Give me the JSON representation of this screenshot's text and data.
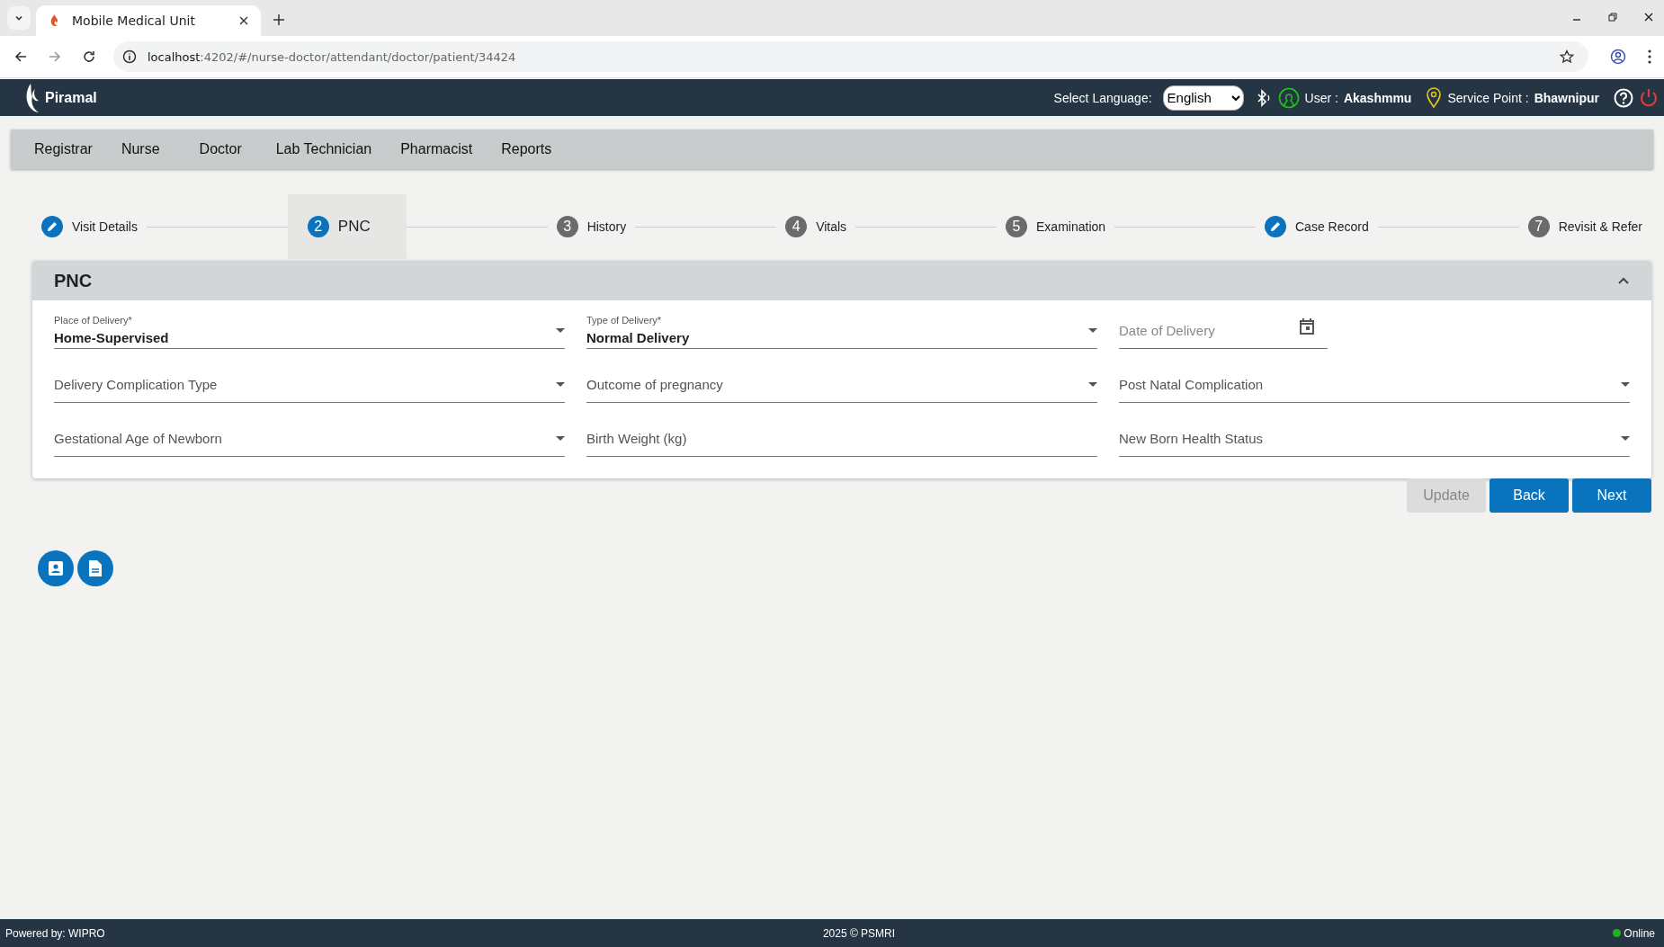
{
  "browser": {
    "tab_title": "Mobile Medical Unit",
    "url_host": "localhost",
    "url_path": ":4202/#/nurse-doctor/attendant/doctor/patient/34424"
  },
  "header": {
    "brand": "Piramal",
    "language_label": "Select Language:",
    "language": "English",
    "user_label": "User :",
    "user": "Akashmmu",
    "service_label": "Service Point :",
    "service_point": "Bhawnipur"
  },
  "menu": [
    "Registrar",
    "Nurse",
    "Doctor",
    "Lab Technician",
    "Pharmacist",
    "Reports"
  ],
  "steps": [
    {
      "label": "Visit Details",
      "kind": "edited",
      "selected": false
    },
    {
      "number": "2",
      "label": "PNC",
      "kind": "numbered",
      "selected": true
    },
    {
      "number": "3",
      "label": "History",
      "kind": "numbered",
      "selected": false
    },
    {
      "number": "4",
      "label": "Vitals",
      "kind": "numbered",
      "selected": false
    },
    {
      "number": "5",
      "label": "Examination",
      "kind": "numbered",
      "selected": false
    },
    {
      "label": "Case Record",
      "kind": "edited",
      "selected": false
    },
    {
      "number": "7",
      "label": "Revisit & Refer",
      "kind": "numbered",
      "selected": false
    }
  ],
  "panel": {
    "title": "PNC",
    "expanded": true,
    "fields": [
      {
        "kind": "select",
        "label": "Place of Delivery*",
        "value": "Home-Supervised",
        "invalid": false
      },
      {
        "kind": "select",
        "label": "Type of Delivery*",
        "value": "Normal Delivery",
        "invalid": false
      },
      {
        "kind": "date",
        "label": "Date of Delivery",
        "invalid": true
      },
      {
        "kind": "select",
        "label": "Delivery Complication Type",
        "invalid": false
      },
      {
        "kind": "select",
        "label": "Outcome of pregnancy",
        "invalid": false
      },
      {
        "kind": "select",
        "label": "Post Natal Complication",
        "invalid": false
      },
      {
        "kind": "select",
        "label": "Gestational Age of Newborn",
        "invalid": false
      },
      {
        "kind": "input",
        "label": "Birth Weight (kg)",
        "invalid": false
      },
      {
        "kind": "select",
        "label": "New Born Health Status",
        "invalid": false
      }
    ]
  },
  "buttons": [
    {
      "label": "Update",
      "disabled": true
    },
    {
      "label": "Back",
      "disabled": false
    },
    {
      "label": "Next",
      "disabled": false
    }
  ],
  "footer": {
    "powered": "Powered by: WIPRO",
    "copyright": "2025 © PSMRI",
    "status": "Online",
    "online": true
  }
}
